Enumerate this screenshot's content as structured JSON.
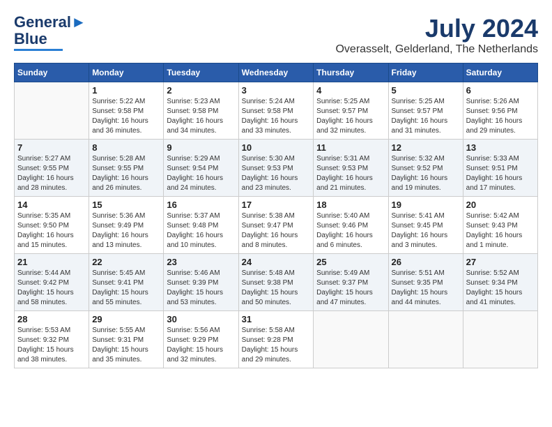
{
  "header": {
    "logo_line1": "General",
    "logo_line2": "Blue",
    "month_year": "July 2024",
    "location": "Overasselt, Gelderland, The Netherlands"
  },
  "columns": [
    "Sunday",
    "Monday",
    "Tuesday",
    "Wednesday",
    "Thursday",
    "Friday",
    "Saturday"
  ],
  "weeks": [
    [
      {
        "day": "",
        "info": ""
      },
      {
        "day": "1",
        "info": "Sunrise: 5:22 AM\nSunset: 9:58 PM\nDaylight: 16 hours\nand 36 minutes."
      },
      {
        "day": "2",
        "info": "Sunrise: 5:23 AM\nSunset: 9:58 PM\nDaylight: 16 hours\nand 34 minutes."
      },
      {
        "day": "3",
        "info": "Sunrise: 5:24 AM\nSunset: 9:58 PM\nDaylight: 16 hours\nand 33 minutes."
      },
      {
        "day": "4",
        "info": "Sunrise: 5:25 AM\nSunset: 9:57 PM\nDaylight: 16 hours\nand 32 minutes."
      },
      {
        "day": "5",
        "info": "Sunrise: 5:25 AM\nSunset: 9:57 PM\nDaylight: 16 hours\nand 31 minutes."
      },
      {
        "day": "6",
        "info": "Sunrise: 5:26 AM\nSunset: 9:56 PM\nDaylight: 16 hours\nand 29 minutes."
      }
    ],
    [
      {
        "day": "7",
        "info": "Sunrise: 5:27 AM\nSunset: 9:55 PM\nDaylight: 16 hours\nand 28 minutes."
      },
      {
        "day": "8",
        "info": "Sunrise: 5:28 AM\nSunset: 9:55 PM\nDaylight: 16 hours\nand 26 minutes."
      },
      {
        "day": "9",
        "info": "Sunrise: 5:29 AM\nSunset: 9:54 PM\nDaylight: 16 hours\nand 24 minutes."
      },
      {
        "day": "10",
        "info": "Sunrise: 5:30 AM\nSunset: 9:53 PM\nDaylight: 16 hours\nand 23 minutes."
      },
      {
        "day": "11",
        "info": "Sunrise: 5:31 AM\nSunset: 9:53 PM\nDaylight: 16 hours\nand 21 minutes."
      },
      {
        "day": "12",
        "info": "Sunrise: 5:32 AM\nSunset: 9:52 PM\nDaylight: 16 hours\nand 19 minutes."
      },
      {
        "day": "13",
        "info": "Sunrise: 5:33 AM\nSunset: 9:51 PM\nDaylight: 16 hours\nand 17 minutes."
      }
    ],
    [
      {
        "day": "14",
        "info": "Sunrise: 5:35 AM\nSunset: 9:50 PM\nDaylight: 16 hours\nand 15 minutes."
      },
      {
        "day": "15",
        "info": "Sunrise: 5:36 AM\nSunset: 9:49 PM\nDaylight: 16 hours\nand 13 minutes."
      },
      {
        "day": "16",
        "info": "Sunrise: 5:37 AM\nSunset: 9:48 PM\nDaylight: 16 hours\nand 10 minutes."
      },
      {
        "day": "17",
        "info": "Sunrise: 5:38 AM\nSunset: 9:47 PM\nDaylight: 16 hours\nand 8 minutes."
      },
      {
        "day": "18",
        "info": "Sunrise: 5:40 AM\nSunset: 9:46 PM\nDaylight: 16 hours\nand 6 minutes."
      },
      {
        "day": "19",
        "info": "Sunrise: 5:41 AM\nSunset: 9:45 PM\nDaylight: 16 hours\nand 3 minutes."
      },
      {
        "day": "20",
        "info": "Sunrise: 5:42 AM\nSunset: 9:43 PM\nDaylight: 16 hours\nand 1 minute."
      }
    ],
    [
      {
        "day": "21",
        "info": "Sunrise: 5:44 AM\nSunset: 9:42 PM\nDaylight: 15 hours\nand 58 minutes."
      },
      {
        "day": "22",
        "info": "Sunrise: 5:45 AM\nSunset: 9:41 PM\nDaylight: 15 hours\nand 55 minutes."
      },
      {
        "day": "23",
        "info": "Sunrise: 5:46 AM\nSunset: 9:39 PM\nDaylight: 15 hours\nand 53 minutes."
      },
      {
        "day": "24",
        "info": "Sunrise: 5:48 AM\nSunset: 9:38 PM\nDaylight: 15 hours\nand 50 minutes."
      },
      {
        "day": "25",
        "info": "Sunrise: 5:49 AM\nSunset: 9:37 PM\nDaylight: 15 hours\nand 47 minutes."
      },
      {
        "day": "26",
        "info": "Sunrise: 5:51 AM\nSunset: 9:35 PM\nDaylight: 15 hours\nand 44 minutes."
      },
      {
        "day": "27",
        "info": "Sunrise: 5:52 AM\nSunset: 9:34 PM\nDaylight: 15 hours\nand 41 minutes."
      }
    ],
    [
      {
        "day": "28",
        "info": "Sunrise: 5:53 AM\nSunset: 9:32 PM\nDaylight: 15 hours\nand 38 minutes."
      },
      {
        "day": "29",
        "info": "Sunrise: 5:55 AM\nSunset: 9:31 PM\nDaylight: 15 hours\nand 35 minutes."
      },
      {
        "day": "30",
        "info": "Sunrise: 5:56 AM\nSunset: 9:29 PM\nDaylight: 15 hours\nand 32 minutes."
      },
      {
        "day": "31",
        "info": "Sunrise: 5:58 AM\nSunset: 9:28 PM\nDaylight: 15 hours\nand 29 minutes."
      },
      {
        "day": "",
        "info": ""
      },
      {
        "day": "",
        "info": ""
      },
      {
        "day": "",
        "info": ""
      }
    ]
  ]
}
